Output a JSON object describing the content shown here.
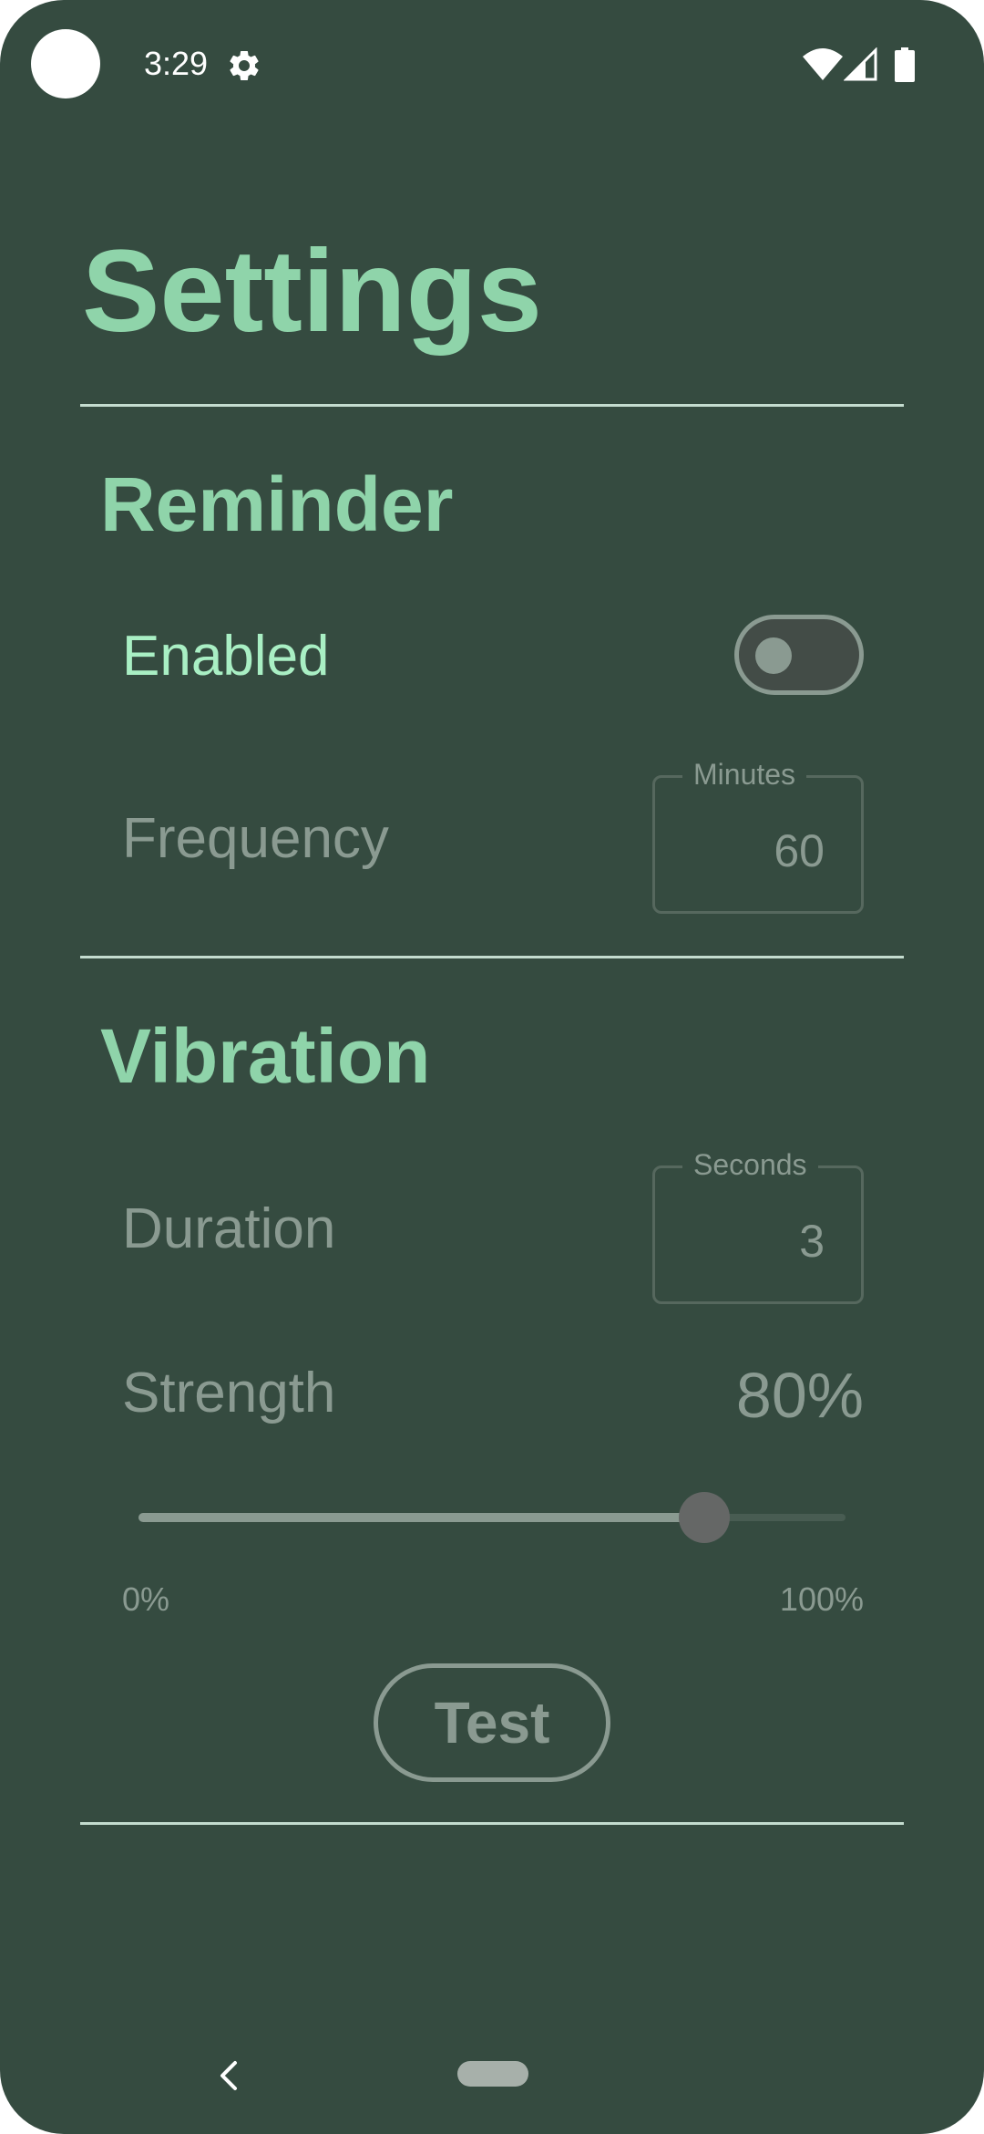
{
  "status_bar": {
    "time": "3:29",
    "icons": [
      "settings-gear-icon",
      "wifi-icon",
      "cellular-signal-icon",
      "battery-icon"
    ]
  },
  "page": {
    "title": "Settings"
  },
  "reminder": {
    "title": "Reminder",
    "enabled_label": "Enabled",
    "enabled_state": "off",
    "frequency_label": "Frequency",
    "frequency_unit_label": "Minutes",
    "frequency_value": "60"
  },
  "vibration": {
    "title": "Vibration",
    "duration_label": "Duration",
    "duration_unit_label": "Seconds",
    "duration_value": "3",
    "strength_label": "Strength",
    "strength_value_text": "80%",
    "strength_value": 0.8,
    "slider_min_label": "0%",
    "slider_max_label": "100%",
    "test_button_label": "Test"
  },
  "nav_bar": {
    "icons": [
      "back-icon",
      "home-pill"
    ]
  },
  "colors": {
    "background": "#354b40",
    "accent": "#8fd4aa",
    "active_text": "#a9efc4",
    "muted_text": "#8a9a91",
    "divider": "#c4dccf"
  }
}
